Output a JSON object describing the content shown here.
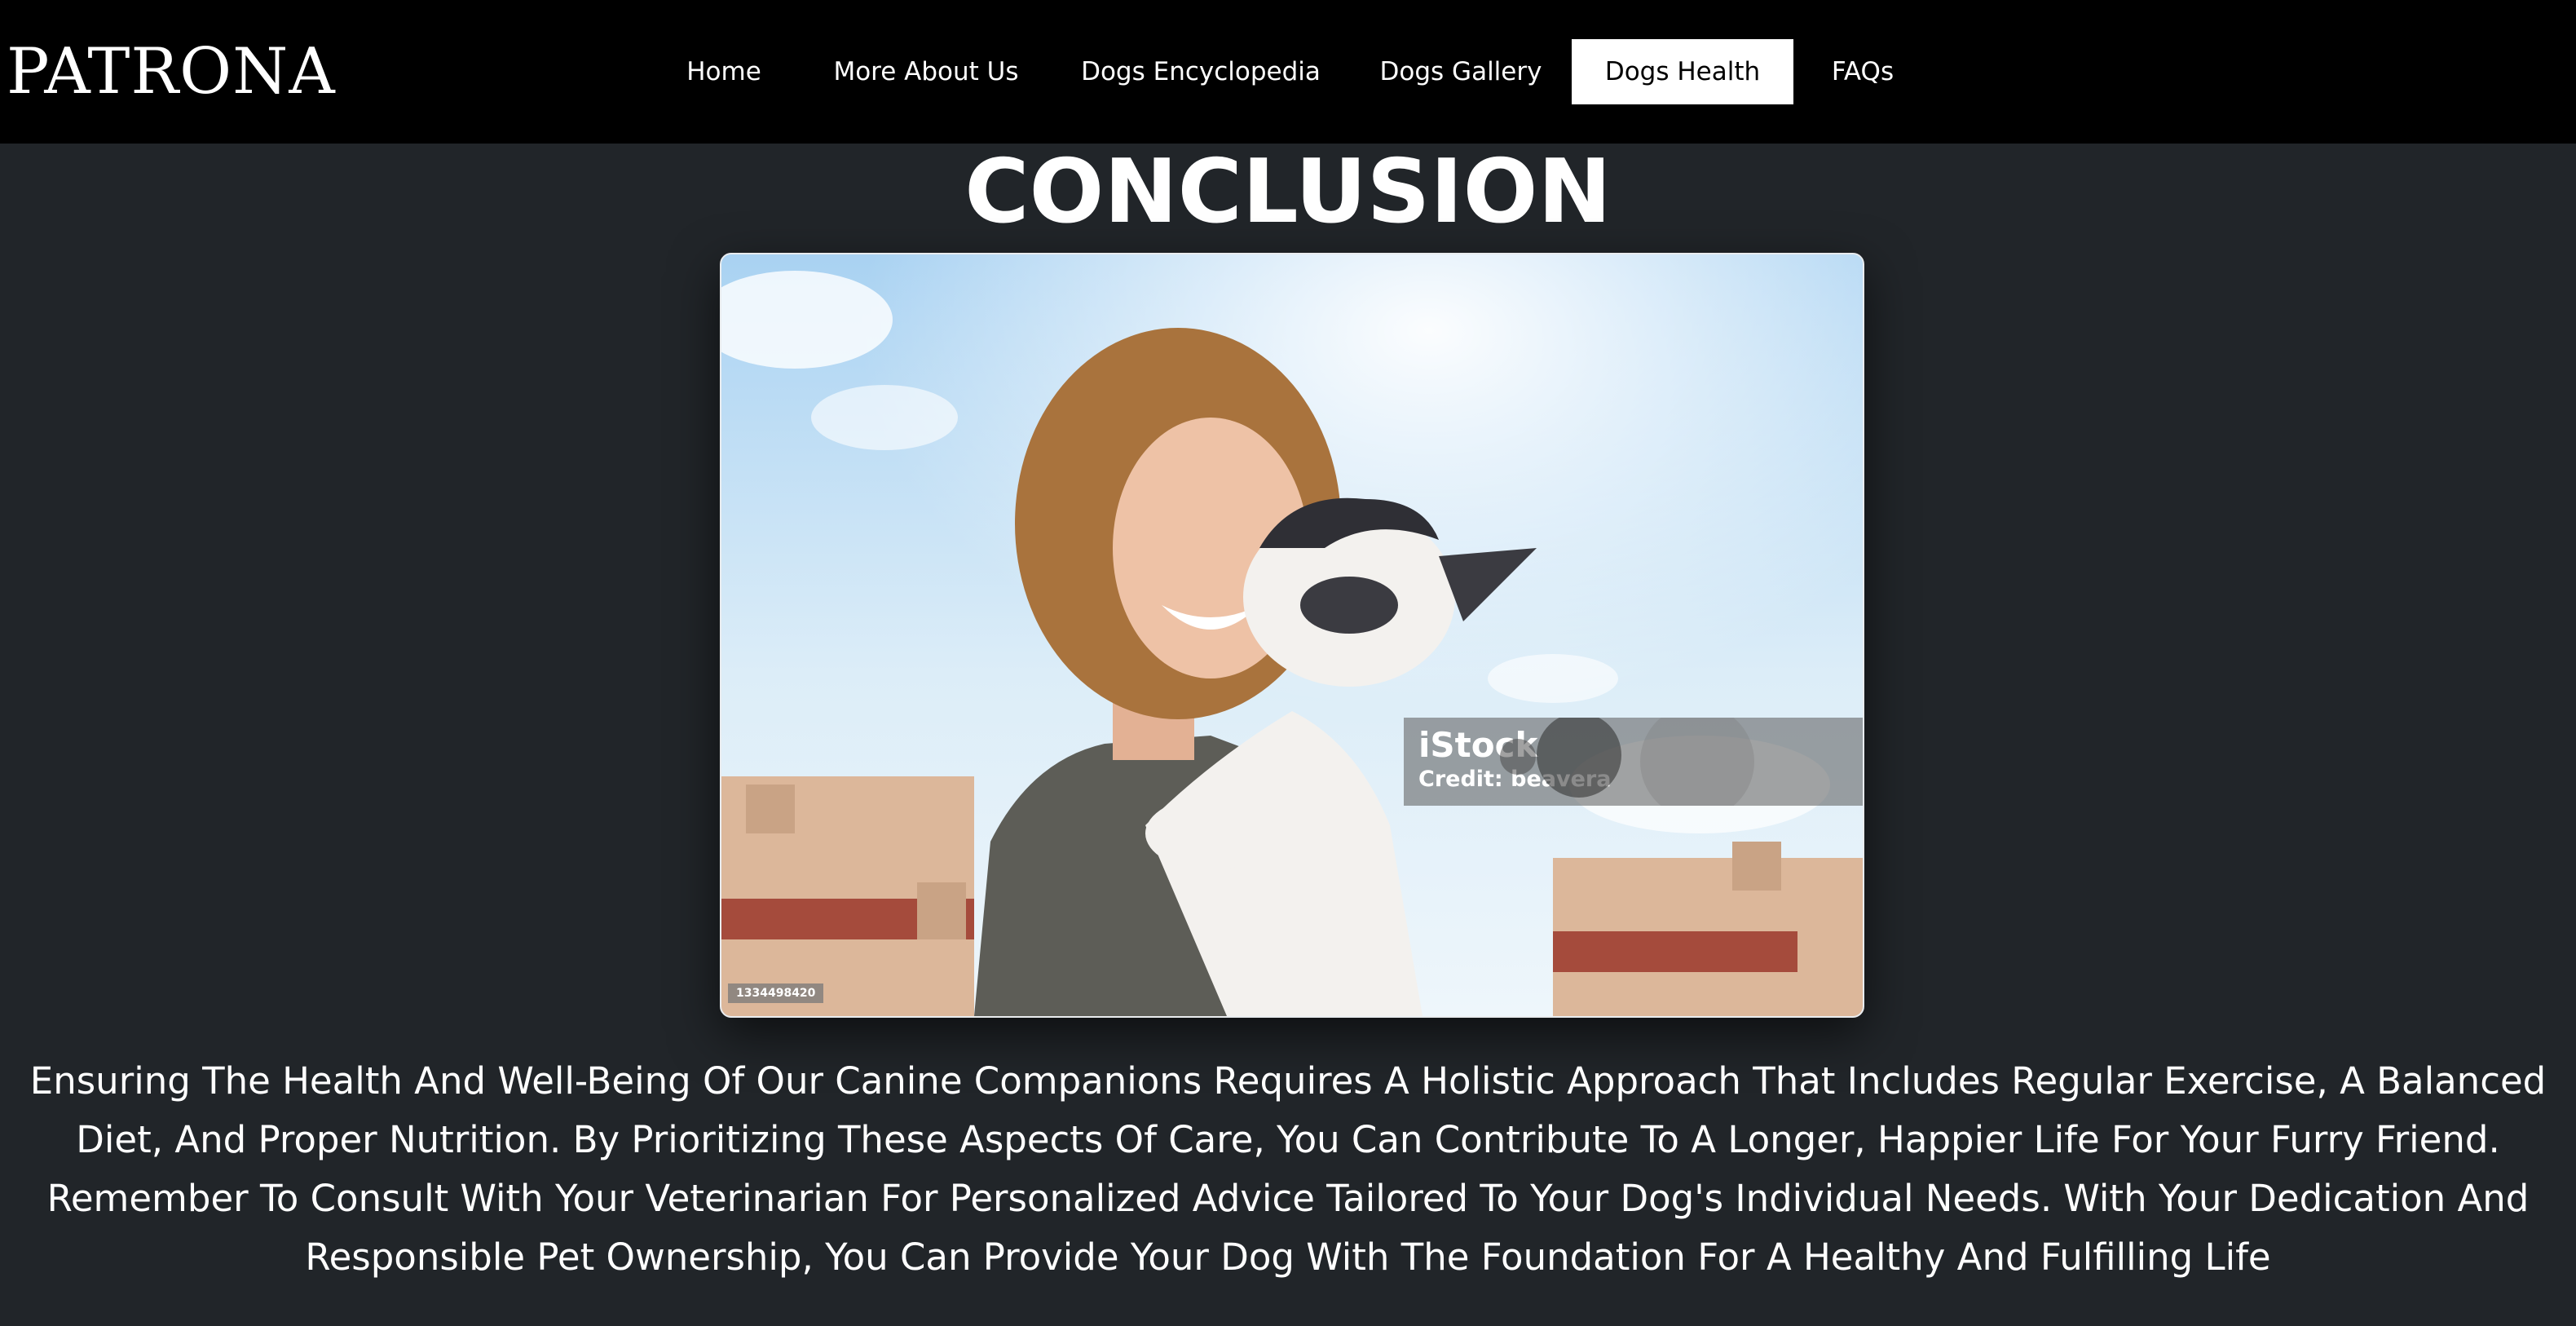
{
  "brand": {
    "name": "PATRONA"
  },
  "nav": {
    "items": [
      {
        "label": "Home",
        "active": false
      },
      {
        "label": "More About Us",
        "active": false
      },
      {
        "label": "Dogs Encyclopedia",
        "active": false
      },
      {
        "label": "Dogs Gallery",
        "active": false
      },
      {
        "label": "Dogs Health",
        "active": true
      },
      {
        "label": "FAQs",
        "active": false
      }
    ]
  },
  "main": {
    "title": "CONCLUSION",
    "image": {
      "watermark_brand": "iStock",
      "watermark_credit": "Credit: beavera",
      "stock_id": "1334498420"
    },
    "paragraph": "Ensuring The Health And Well-Being Of Our Canine Companions Requires A Holistic Approach That Includes Regular Exercise, A Balanced Diet, And Proper Nutrition. By Prioritizing These Aspects Of Care, You Can Contribute To A Longer, Happier Life For Your Furry Friend. Remember To Consult With Your Veterinarian For Personalized Advice Tailored To Your Dog's Individual Needs. With Your Dedication And Responsible Pet Ownership, You Can Provide Your Dog With The Foundation For A Healthy And Fulfilling Life"
  },
  "colors": {
    "page_background": "#212529",
    "navbar_background": "#000000",
    "active_nav_background": "#ffffff",
    "text": "#ffffff"
  }
}
